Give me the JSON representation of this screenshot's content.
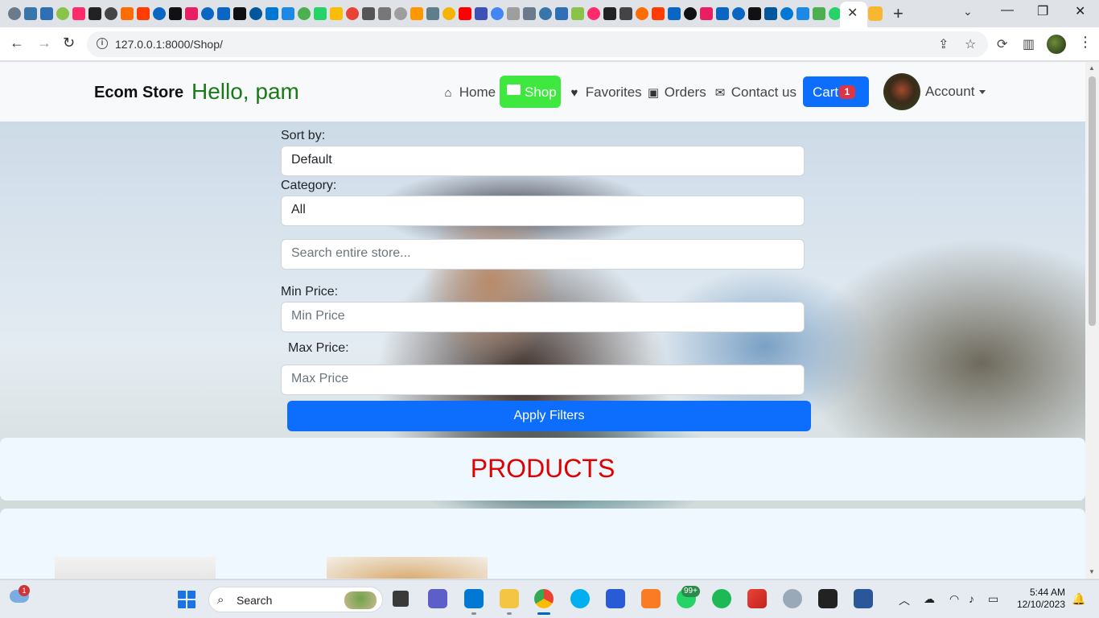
{
  "browser": {
    "active_tab_close": "✕",
    "new_tab": "+",
    "url": "127.0.0.1:8000/Shop/"
  },
  "navbar": {
    "brand": "Ecom Store",
    "greeting": "Hello, pam",
    "links": {
      "home": "Home",
      "shop": "Shop",
      "favorites": "Favorites",
      "orders": "Orders",
      "contact": "Contact us"
    },
    "cart_label": "Cart",
    "cart_count": "1",
    "account_label": "Account"
  },
  "filters": {
    "sort_label": "Sort by:",
    "sort_value": "Default",
    "category_label": "Category:",
    "category_value": "All",
    "search_placeholder": "Search entire store...",
    "min_price_label": "Min Price:",
    "min_price_placeholder": "Min Price",
    "max_price_label": "Max Price:",
    "max_price_placeholder": "Max Price",
    "apply_label": "Apply Filters"
  },
  "products": {
    "heading": "PRODUCTS"
  },
  "taskbar": {
    "weather_badge": "1",
    "search_label": "Search",
    "whatsapp_badge": "99+",
    "time": "5:44 AM",
    "date": "12/10/2023"
  },
  "colors": {
    "brand_green": "#1a7a1a",
    "shop_active": "#3ee83e",
    "primary": "#0d6efd",
    "badge_red": "#dc3545",
    "products_red": "#e00000"
  },
  "icons": {
    "home": "home-icon",
    "shop": "store-icon",
    "favorites": "heart-icon",
    "orders": "shopping-bag-icon",
    "contact": "envelope-icon"
  }
}
